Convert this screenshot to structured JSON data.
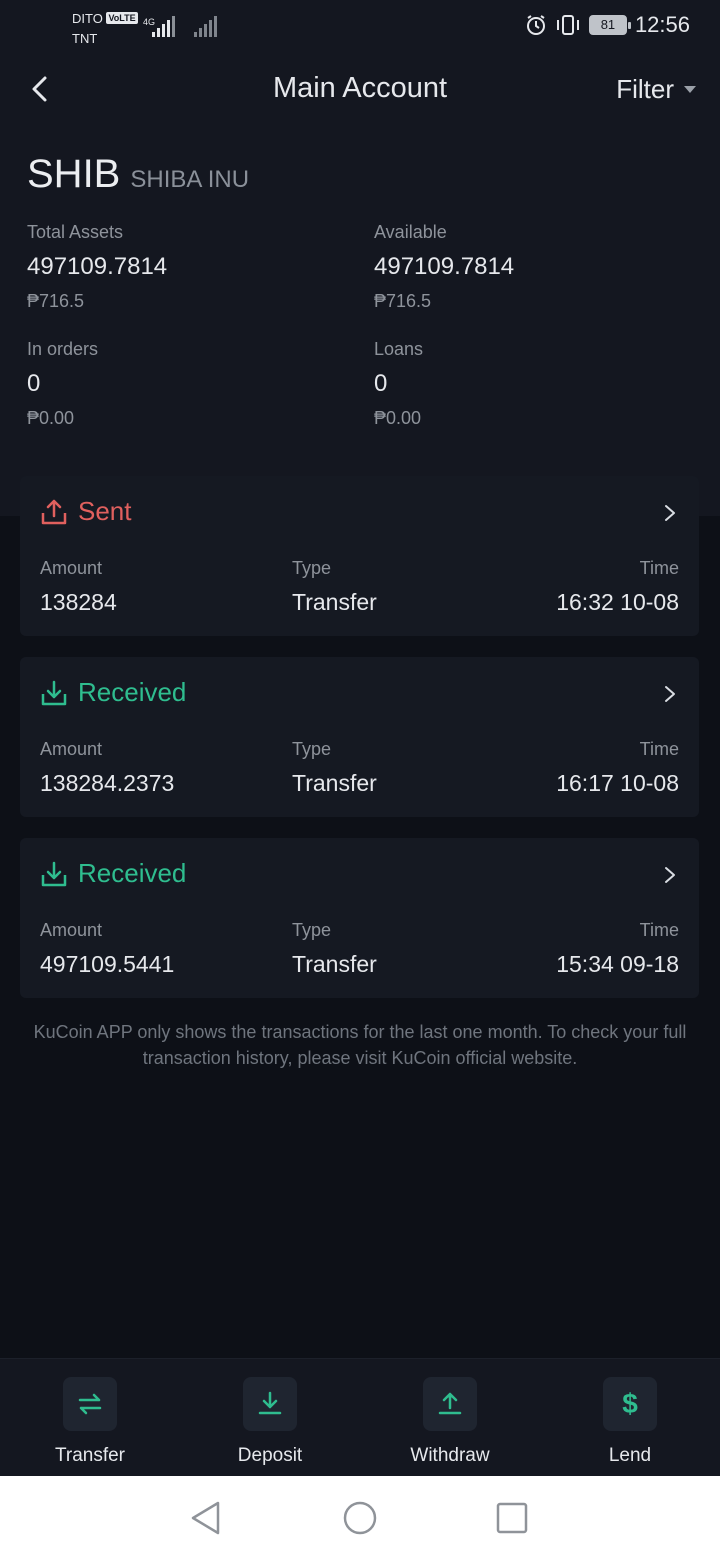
{
  "status": {
    "carrier1": "DITO",
    "volte": "VoLTE",
    "carrier2": "TNT",
    "net": "4G",
    "battery": "81",
    "time": "12:56"
  },
  "header": {
    "title": "Main Account",
    "filter": "Filter"
  },
  "coin": {
    "symbol": "SHIB",
    "name": "SHIBA INU"
  },
  "stats": {
    "total": {
      "label": "Total Assets",
      "value": "497109.7814",
      "fiat": "₱716.5"
    },
    "available": {
      "label": "Available",
      "value": "497109.7814",
      "fiat": "₱716.5"
    },
    "in_orders": {
      "label": "In orders",
      "value": "0",
      "fiat": "₱0.00"
    },
    "loans": {
      "label": "Loans",
      "value": "0",
      "fiat": "₱0.00"
    }
  },
  "transactions": [
    {
      "kind": "Sent",
      "amount_label": "Amount",
      "amount": "138284",
      "type_label": "Type",
      "type": "Transfer",
      "time_label": "Time",
      "time": "16:32 10-08"
    },
    {
      "kind": "Received",
      "amount_label": "Amount",
      "amount": "138284.2373",
      "type_label": "Type",
      "type": "Transfer",
      "time_label": "Time",
      "time": "16:17 10-08"
    },
    {
      "kind": "Received",
      "amount_label": "Amount",
      "amount": "497109.5441",
      "type_label": "Type",
      "type": "Transfer",
      "time_label": "Time",
      "time": "15:34 09-18"
    }
  ],
  "note": "KuCoin APP only shows the transactions for the last one month. To check your full transaction history, please visit KuCoin official website.",
  "actions": {
    "transfer": "Transfer",
    "deposit": "Deposit",
    "withdraw": "Withdraw",
    "lend": "Lend"
  },
  "colors": {
    "sent": "#e0605e",
    "received": "#2fbd8f",
    "accent": "#2fbd8f"
  }
}
